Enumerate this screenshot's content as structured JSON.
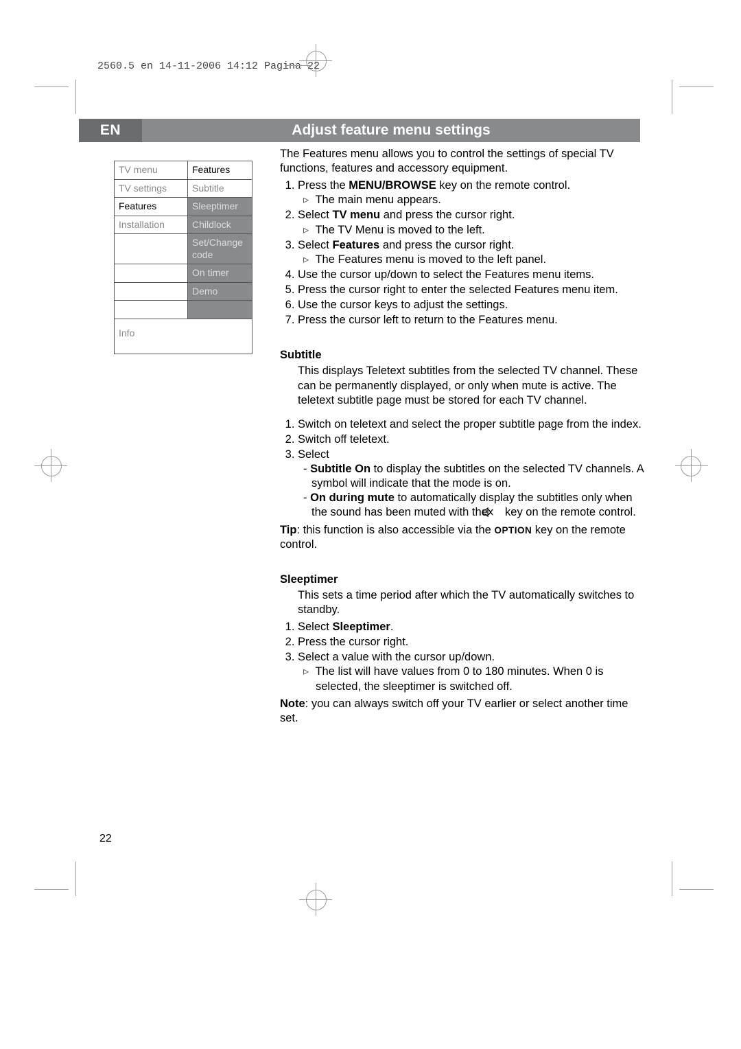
{
  "header_line": "2560.5 en  14-11-2006  14:12  Pagina 22",
  "lang_code": "EN",
  "page_title": "Adjust feature menu settings",
  "menu": {
    "left_header": "TV menu",
    "right_header": "Features",
    "rows": [
      {
        "l": "TV settings",
        "r": "Subtitle",
        "l_dim": true,
        "r_highlight": true
      },
      {
        "l": "Features",
        "r": "Sleeptimer",
        "l_dim": false,
        "r_highlight": false
      },
      {
        "l": "Installation",
        "r": "Childlock",
        "l_dim": true,
        "r_highlight": false
      },
      {
        "l": "",
        "r": "Set/Change code"
      },
      {
        "l": "",
        "r": "On timer"
      },
      {
        "l": "",
        "r": "Demo"
      },
      {
        "l": "",
        "r": ""
      }
    ],
    "info": "Info"
  },
  "intro": "The Features menu allows you to control the settings of special TV functions, features and accessory equipment.",
  "steps": {
    "s1a": "Press the ",
    "s1b": "MENU/BROWSE",
    "s1c": " key on the remote control.",
    "s1sub": "The main menu appears.",
    "s2a": "Select ",
    "s2b": "TV menu",
    "s2c": " and press the cursor right.",
    "s2sub": "The TV Menu is moved to the left.",
    "s3a": "Select ",
    "s3b": "Features",
    "s3c": " and press the cursor right.",
    "s3sub": "The Features menu is moved to the left panel.",
    "s4": "Use the cursor up/down to select the Features menu items.",
    "s5": "Press the cursor right to enter the selected Features menu item.",
    "s6": "Use the cursor keys to adjust the settings.",
    "s7": "Press the cursor left to return to the Features menu."
  },
  "subtitle": {
    "heading": "Subtitle",
    "intro": "This displays Teletext subtitles from the selected TV channel. These can be permanently displayed, or only when mute is active. The teletext subtitle page must be stored for each TV channel.",
    "st1": "Switch on teletext and select the proper subtitle page from the index.",
    "st2": "Switch off teletext.",
    "st3": "Select",
    "d1a": "Subtitle On",
    "d1b": " to display the subtitles on the selected TV channels.  A symbol will indicate that the mode is on.",
    "d2a": "On during mute",
    "d2b": " to automatically display the subtitles only when the sound has been muted with the ",
    "d2c": " key on the remote control.",
    "tip_label": "Tip",
    "tip_a": ": this function is also accessible via the ",
    "tip_b": "OPTION",
    "tip_c": " key on the remote control."
  },
  "sleeptimer": {
    "heading": "Sleeptimer",
    "intro": "This sets a time period after which the TV automatically switches to standby.",
    "s1a": "Select ",
    "s1b": "Sleeptimer",
    "s1c": ".",
    "s2": "Press the cursor right.",
    "s3": "Select a value with the cursor up/down.",
    "s3sub": "The list will have values from 0 to 180 minutes. When 0 is selected, the sleeptimer is switched off.",
    "note_label": "Note",
    "note_text": ": you can always switch off your TV earlier or select another time set."
  },
  "page_number": "22"
}
